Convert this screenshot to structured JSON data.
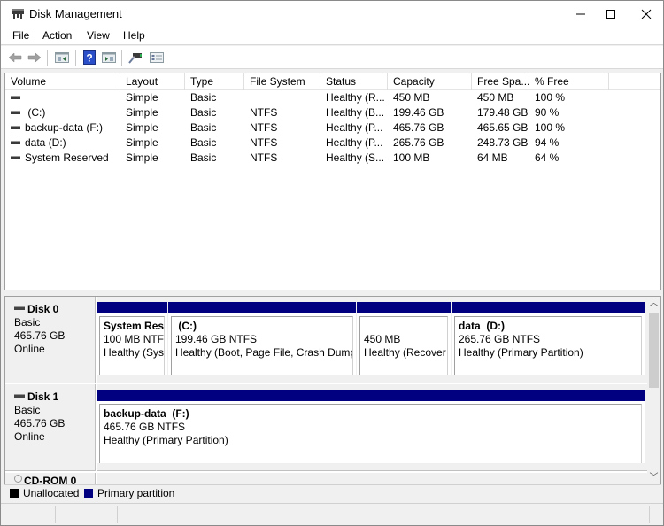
{
  "window": {
    "title": "Disk Management",
    "controls": {
      "minimize": "–",
      "maximize": "☐",
      "close": "✕"
    }
  },
  "menu": [
    "File",
    "Action",
    "View",
    "Help"
  ],
  "toolbar": {
    "buttons": [
      "back-icon",
      "forward-icon",
      "show-hide-console-tree-icon",
      "help-icon",
      "show-hide-action-pane-icon",
      "connect-icon",
      "properties-icon"
    ]
  },
  "volume_list": {
    "columns": [
      "Volume",
      "Layout",
      "Type",
      "File System",
      "Status",
      "Capacity",
      "Free Spa...",
      "% Free"
    ],
    "rows": [
      {
        "volume": "",
        "layout": "Simple",
        "type": "Basic",
        "fs": "",
        "status": "Healthy (R...",
        "capacity": "450 MB",
        "free": "450 MB",
        "pct": "100 %"
      },
      {
        "volume": " (C:)",
        "layout": "Simple",
        "type": "Basic",
        "fs": "NTFS",
        "status": "Healthy (B...",
        "capacity": "199.46 GB",
        "free": "179.48 GB",
        "pct": "90 %"
      },
      {
        "volume": "backup-data (F:)",
        "layout": "Simple",
        "type": "Basic",
        "fs": "NTFS",
        "status": "Healthy (P...",
        "capacity": "465.76 GB",
        "free": "465.65 GB",
        "pct": "100 %"
      },
      {
        "volume": "data (D:)",
        "layout": "Simple",
        "type": "Basic",
        "fs": "NTFS",
        "status": "Healthy (P...",
        "capacity": "265.76 GB",
        "free": "248.73 GB",
        "pct": "94 %"
      },
      {
        "volume": "System Reserved",
        "layout": "Simple",
        "type": "Basic",
        "fs": "NTFS",
        "status": "Healthy (S...",
        "capacity": "100 MB",
        "free": "64 MB",
        "pct": "64 %"
      }
    ]
  },
  "disks": [
    {
      "name": "Disk 0",
      "type": "Basic",
      "size": "465.76 GB",
      "state": "Online",
      "partitions": [
        {
          "name": "System Res",
          "line2": "100 MB NTF",
          "line3": "Healthy (Sys"
        },
        {
          "name": " (C:)",
          "line2": "199.46 GB NTFS",
          "line3": "Healthy (Boot, Page File, Crash Dump,"
        },
        {
          "name": "",
          "line2": "450 MB",
          "line3": "Healthy (Recover"
        },
        {
          "name": "data  (D:)",
          "line2": "265.76 GB NTFS",
          "line3": "Healthy (Primary Partition)"
        }
      ]
    },
    {
      "name": "Disk 1",
      "type": "Basic",
      "size": "465.76 GB",
      "state": "Online",
      "partitions": [
        {
          "name": "backup-data  (F:)",
          "line2": "465.76 GB NTFS",
          "line3": "Healthy (Primary Partition)"
        }
      ]
    }
  ],
  "cdrom": {
    "name": "CD-ROM 0"
  },
  "legend": [
    {
      "label": "Unallocated",
      "color": "#000000"
    },
    {
      "label": "Primary partition",
      "color": "#000080"
    }
  ],
  "colors": {
    "partition_bar": "#000080"
  }
}
